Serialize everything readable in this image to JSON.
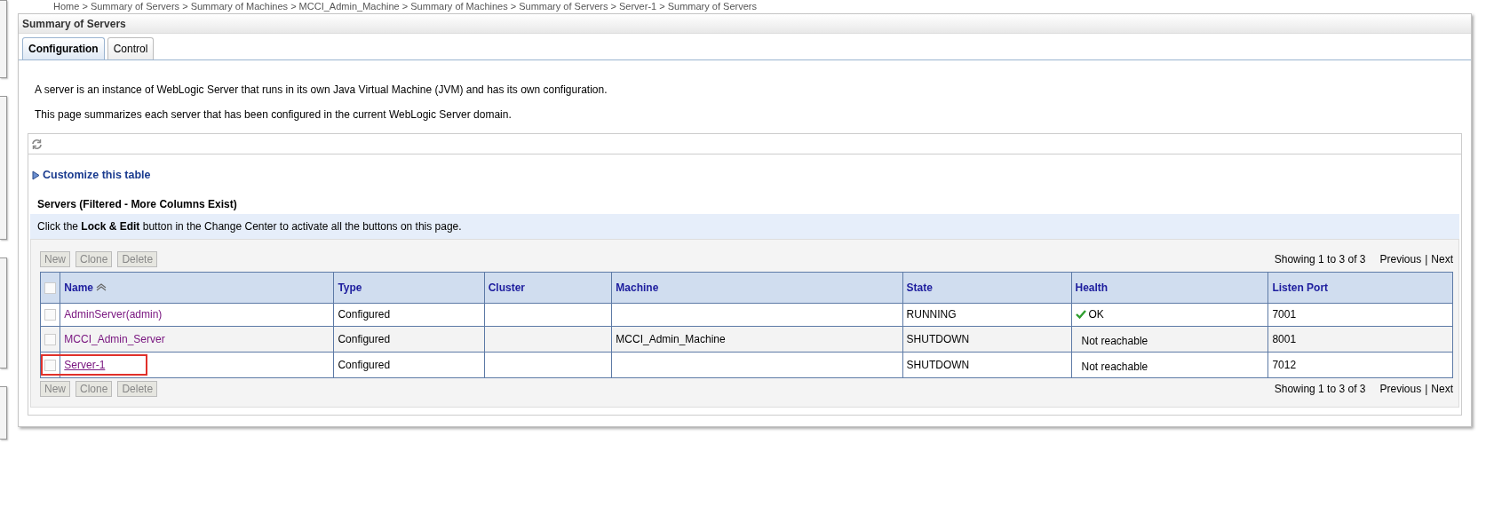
{
  "breadcrumb": "Home > Summary of Servers > Summary of Machines > MCCI_Admin_Machine > Summary of Machines > Summary of Servers > Server-1 > Summary of Servers",
  "panel_title": "Summary of Servers",
  "tabs": [
    {
      "label": "Configuration",
      "selected": true
    },
    {
      "label": "Control",
      "selected": false
    }
  ],
  "description": [
    "A server is an instance of WebLogic Server that runs in its own Java Virtual Machine (JVM) and has its own configuration.",
    "This page summarizes each server that has been configured in the current WebLogic Server domain."
  ],
  "customize_link": "Customize this table",
  "table_title": "Servers (Filtered - More Columns Exist)",
  "info_message": "Click the **Lock & Edit** button in the Change Center to activate all the buttons on this page.",
  "top_controls": {
    "buttons": [
      {
        "label": "New",
        "disabled": true
      },
      {
        "label": "Clone",
        "disabled": true
      },
      {
        "label": "Delete",
        "disabled": true
      }
    ],
    "pagination": {
      "showing": "Showing 1 to 3 of 3",
      "previous": "Previous",
      "separator": "|",
      "next": "Next"
    }
  },
  "select_all_checked": false,
  "columns": [
    {
      "label": "Name",
      "sorted": true
    },
    {
      "label": "Type",
      "sorted": false
    },
    {
      "label": "Cluster",
      "sorted": false
    },
    {
      "label": "Machine",
      "sorted": false
    },
    {
      "label": "State",
      "sorted": false
    },
    {
      "label": "Health",
      "sorted": false
    },
    {
      "label": "Listen Port",
      "sorted": false
    }
  ],
  "rows": [
    {
      "checked": false,
      "highlighted": false,
      "name": "AdminServer(admin)",
      "type": "Configured",
      "machine": "",
      "state": "RUNNING",
      "health": {
        "kind": "ok",
        "text": "OK"
      },
      "listen_port": "7001"
    },
    {
      "checked": false,
      "highlighted": false,
      "name": "MCCI_Admin_Server",
      "type": "Configured",
      "machine": "MCCI_Admin_Machine",
      "state": "SHUTDOWN",
      "health": {
        "kind": "unknown",
        "text": "Not reachable"
      },
      "listen_port": "8001"
    },
    {
      "checked": false,
      "highlighted": true,
      "name": "Server-1",
      "type": "Configured",
      "machine": "",
      "state": "SHUTDOWN",
      "health": {
        "kind": "unknown",
        "text": "Not reachable"
      },
      "listen_port": "7012"
    }
  ],
  "bottom_controls": {
    "buttons": [
      {
        "label": "New",
        "disabled": true
      },
      {
        "label": "Clone",
        "disabled": true
      },
      {
        "label": "Delete",
        "disabled": true
      }
    ],
    "pagination": {
      "showing": "Showing 1 to 3 of 3",
      "previous": "Previous",
      "separator": "|",
      "next": "Next"
    }
  }
}
